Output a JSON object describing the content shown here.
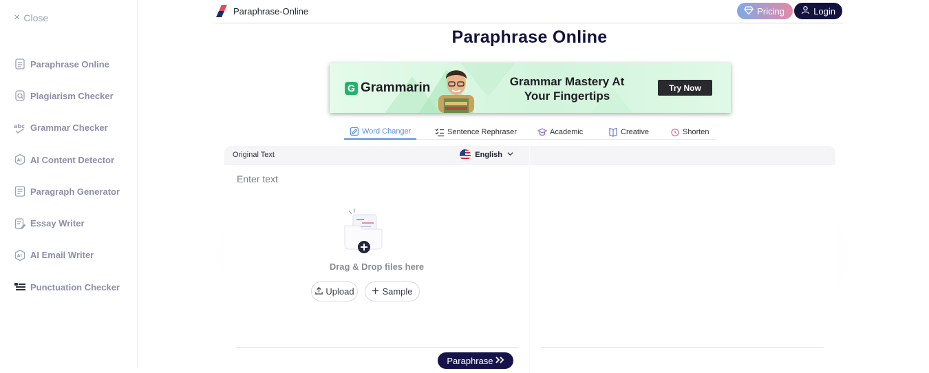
{
  "sidebar": {
    "close_label": "Close",
    "items": [
      {
        "label": "Paraphrase Online",
        "icon": "document-icon"
      },
      {
        "label": "Plagiarism Checker",
        "icon": "plagiarism-icon"
      },
      {
        "label": "Grammar Checker",
        "icon": "abc-icon"
      },
      {
        "label": "AI Content Detector",
        "icon": "ai-gear-icon"
      },
      {
        "label": "Paragraph Generator",
        "icon": "paragraph-icon"
      },
      {
        "label": "Essay Writer",
        "icon": "essay-pen-icon"
      },
      {
        "label": "AI Email Writer",
        "icon": "ai-gear-icon"
      },
      {
        "label": "Punctuation Checker",
        "icon": "punctuation-icon"
      }
    ]
  },
  "header": {
    "logo_text": "Paraphrase-Online",
    "pricing_label": "Pricing",
    "login_label": "Login"
  },
  "page_title": "Paraphrase Online",
  "banner": {
    "brand": "Grammarin",
    "headline_line1": "Grammar Mastery At",
    "headline_line2": "Your Fingertips",
    "cta": "Try Now"
  },
  "tabs": [
    {
      "label": "Word Changer",
      "active": true
    },
    {
      "label": "Sentence Rephraser",
      "active": false
    },
    {
      "label": "Academic",
      "active": false
    },
    {
      "label": "Creative",
      "active": false
    },
    {
      "label": "Shorten",
      "active": false
    }
  ],
  "editor": {
    "left_title": "Original Text",
    "language": "English",
    "placeholder": "Enter text",
    "drop_text": "Drag & Drop files here",
    "upload_label": "Upload",
    "sample_label": "Sample",
    "paraphrase_label": "Paraphrase"
  },
  "colors": {
    "brand_dark": "#14133d",
    "accent_blue": "#5a8ed8",
    "sidebar_text": "#8c8fa8"
  }
}
